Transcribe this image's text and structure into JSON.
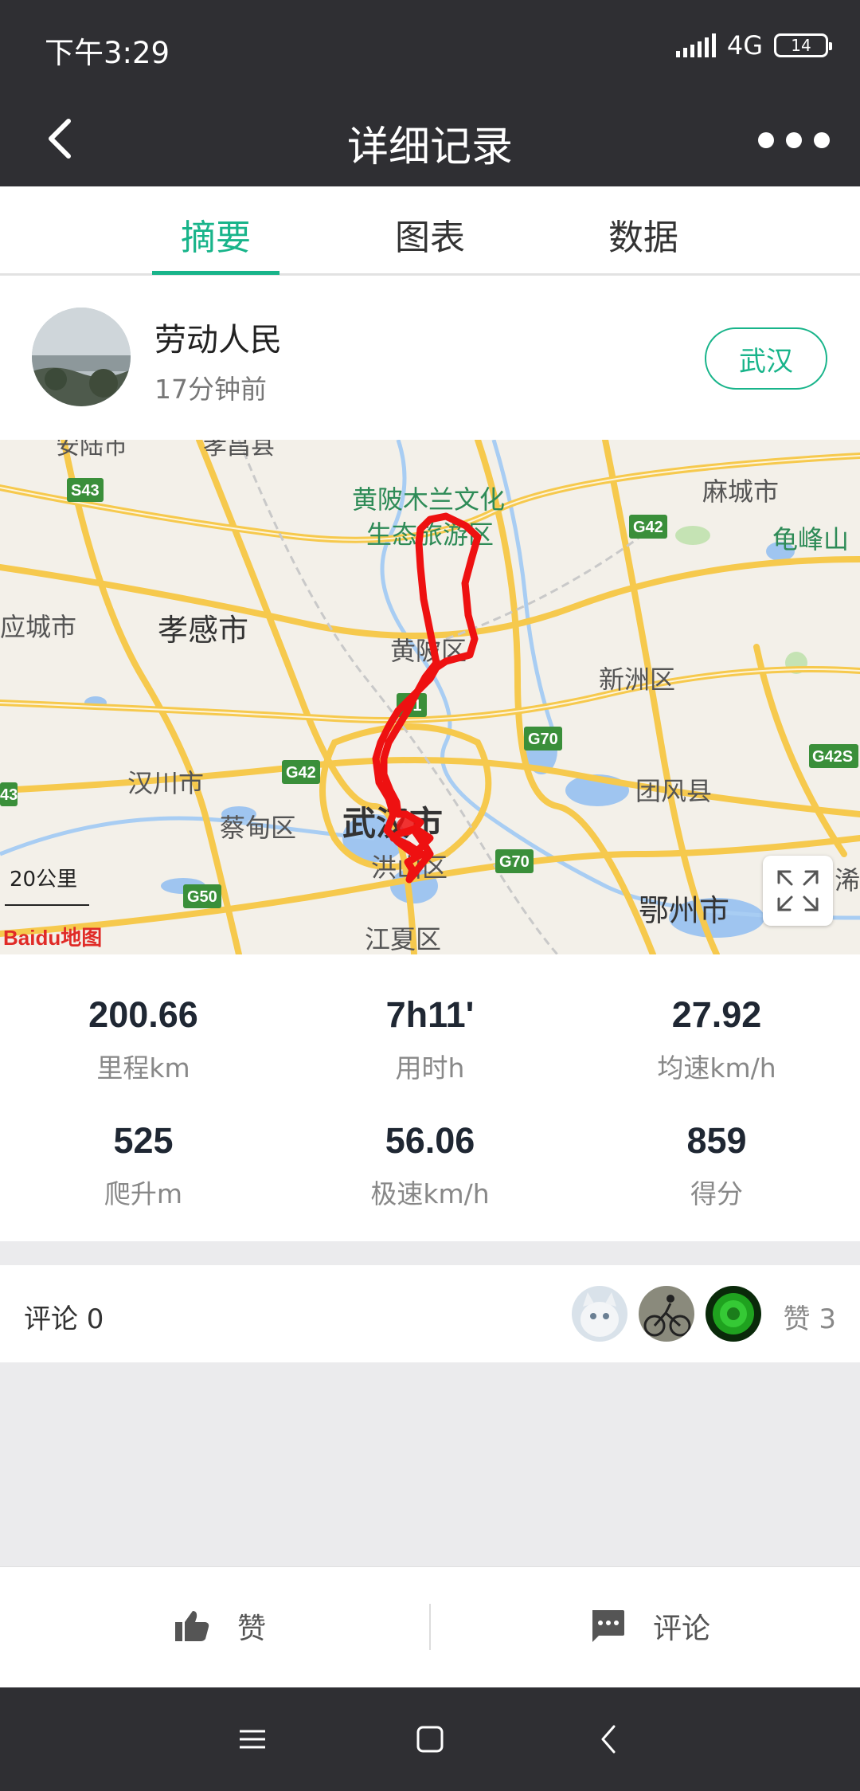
{
  "status": {
    "time": "下午3:29",
    "network": "4G",
    "battery": "14"
  },
  "header": {
    "title": "详细记录"
  },
  "tabs": [
    {
      "label": "摘要",
      "active": true
    },
    {
      "label": "图表",
      "active": false
    },
    {
      "label": "数据",
      "active": false
    }
  ],
  "user": {
    "name": "劳动人民",
    "time_ago": "17分钟前",
    "city": "武汉"
  },
  "map": {
    "labels": {
      "anlu": "安陆市",
      "xiaochang": "孝昌县",
      "huangpi_scenic_1": "黄陂木兰文化",
      "huangpi_scenic_2": "生态旅游区",
      "macheng": "麻城市",
      "guifengshan": "龟峰山",
      "yingcheng": "应城市",
      "xiaogan": "孝感市",
      "huangpi": "黄陂区",
      "xinzhou": "新洲区",
      "hanchuan": "汉川市",
      "tuanfeng": "团风县",
      "caidian": "蔡甸区",
      "wuhan": "武汉市",
      "hongshan": "洪山区",
      "ezhou": "鄂州市",
      "jiangxia": "江夏区",
      "xishui": "浠"
    },
    "shields": [
      "S43",
      "G42",
      "S1",
      "G70",
      "G42",
      "G42S",
      "G70",
      "G50",
      "43"
    ],
    "scale": "20公里",
    "brand": "Baidu地图",
    "route_color": "#ee1111"
  },
  "stats": [
    {
      "value": "200.66",
      "label": "里程km"
    },
    {
      "value": "7h11'",
      "label": "用时h"
    },
    {
      "value": "27.92",
      "label": "均速km/h"
    },
    {
      "value": "525",
      "label": "爬升m"
    },
    {
      "value": "56.06",
      "label": "极速km/h"
    },
    {
      "value": "859",
      "label": "得分"
    }
  ],
  "social": {
    "comments": "评论  0",
    "likes": "赞  3"
  },
  "actions": {
    "like": "赞",
    "comment": "评论"
  },
  "colors": {
    "accent": "#18b48a",
    "header_bg": "#2f2f33"
  }
}
